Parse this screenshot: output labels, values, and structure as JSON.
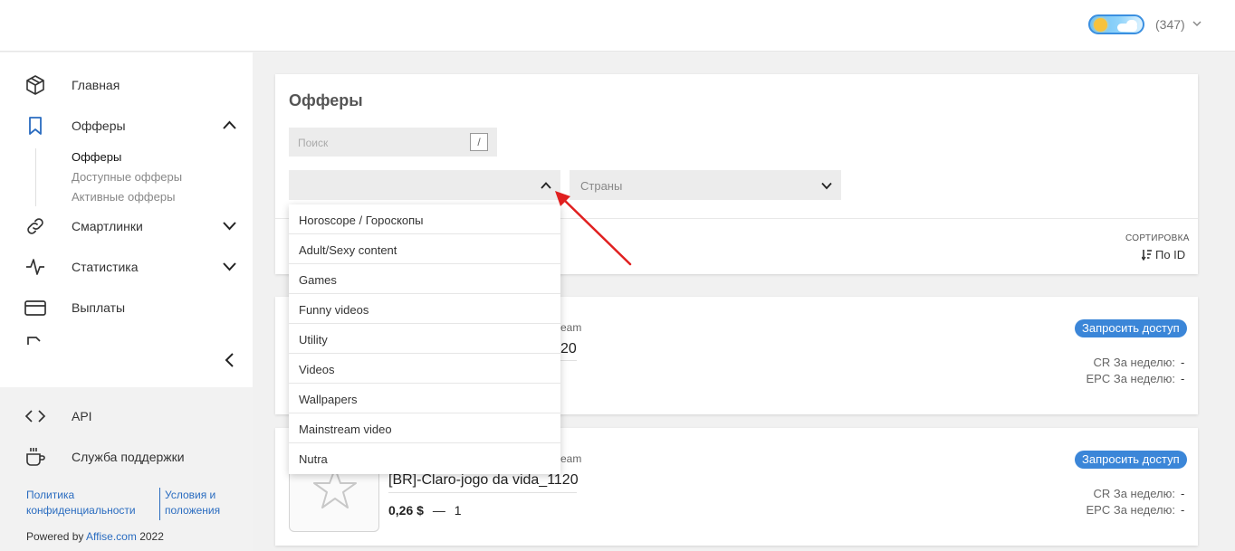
{
  "header": {
    "user_count": "(347)"
  },
  "sidebar": {
    "items": [
      {
        "label": "Главная"
      },
      {
        "label": "Офферы"
      },
      {
        "label": "Смартлинки"
      },
      {
        "label": "Статистика"
      },
      {
        "label": "Выплаты"
      }
    ],
    "offers_sub": [
      "Офферы",
      "Доступные офферы",
      "Активные офферы"
    ],
    "api_label": "API",
    "support_label": "Служба поддержки",
    "footer": {
      "privacy_line1": "Политика",
      "privacy_line2": "конфиденциальности",
      "terms_line1": "Условия и",
      "terms_line2": "положения",
      "powered_by": "Powered by",
      "powered_link": "Affise.com",
      "year": "2022"
    }
  },
  "main": {
    "title": "Офферы",
    "search_placeholder": "Поиск",
    "search_shortcut": "/",
    "category_value": "",
    "countries_placeholder": "Страны",
    "sort_label": "СОРТИРОВКА",
    "sort_value": "По ID",
    "category_options": [
      "Horoscope / Гороскопы",
      "Adult/Sexy content",
      "Games",
      "Funny videos",
      "Utility",
      "Videos",
      "Wallpapers",
      "Mainstream video",
      "Nutra"
    ],
    "offers": [
      {
        "category_partial": "eam",
        "title_partial": "20",
        "request_label": "Запросить доступ",
        "cr_label": "CR За неделю:",
        "cr_value": "-",
        "epc_label": "EPC За неделю:",
        "epc_value": "-"
      },
      {
        "category_partial": "eam",
        "title": "[BR]-Claro-jogo da vida_1120",
        "price": "0,26 $",
        "dash": "—",
        "count": "1",
        "request_label": "Запросить доступ",
        "cr_label": "CR За неделю:",
        "cr_value": "-",
        "epc_label": "EPC За неделю:",
        "epc_value": "-"
      }
    ]
  },
  "colors": {
    "accent": "#3b86d8",
    "link": "#2a6cc0",
    "arrow": "#e02020"
  }
}
